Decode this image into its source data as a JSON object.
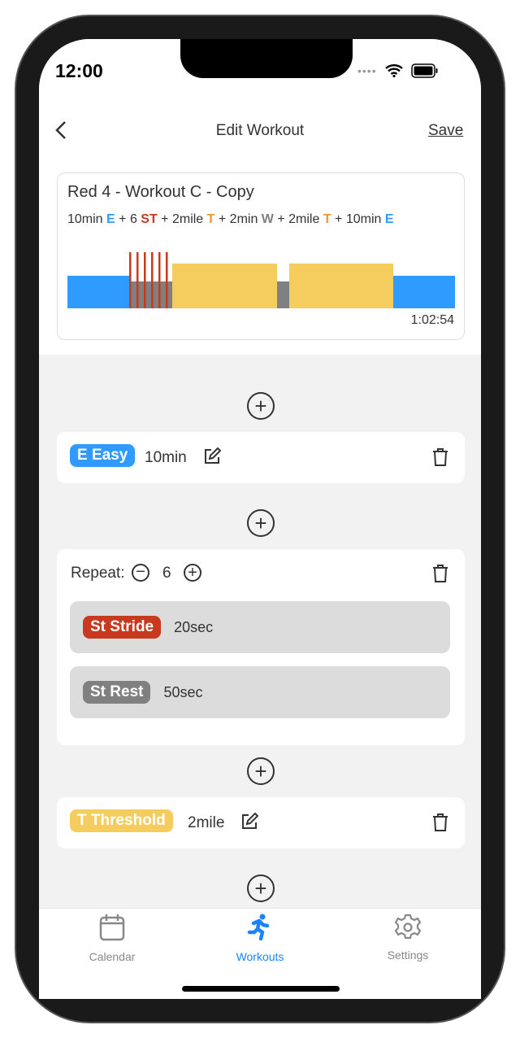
{
  "status": {
    "time": "12:00"
  },
  "header": {
    "title": "Edit Workout",
    "save_label": "Save"
  },
  "workout": {
    "name": "Red 4 - Workout C - Copy",
    "summary": [
      {
        "text": "10min "
      },
      {
        "code": "E",
        "color": "#2f9bff"
      },
      {
        "text": " + 6 "
      },
      {
        "code": "ST",
        "color": "#c8391e"
      },
      {
        "text": " + 2mile "
      },
      {
        "code": "T",
        "color": "#ec9a2a"
      },
      {
        "text": " + 2min "
      },
      {
        "code": "W",
        "color": "#808080"
      },
      {
        "text": " + 2mile "
      },
      {
        "code": "T",
        "color": "#ec9a2a"
      },
      {
        "text": " + 10min "
      },
      {
        "code": "E",
        "color": "#2f9bff"
      }
    ],
    "total_time": "1:02:54"
  },
  "colors": {
    "easy": "#2f9bff",
    "stride": "#c8391e",
    "rest": "#808080",
    "threshold": "#f5cd5e",
    "accent": "#1a84ff"
  },
  "steps": {
    "easy": {
      "badge": "E Easy",
      "value": "10min"
    },
    "repeat": {
      "label": "Repeat:",
      "count": "6",
      "stride": {
        "badge": "St Stride",
        "value": "20sec"
      },
      "rest": {
        "badge": "St Rest",
        "value": "50sec"
      }
    },
    "threshold": {
      "badge": "T Threshold",
      "value": "2mile"
    }
  },
  "tabs": [
    {
      "label": "Calendar",
      "icon": "calendar-icon"
    },
    {
      "label": "Workouts",
      "icon": "running-icon",
      "active": true
    },
    {
      "label": "Settings",
      "icon": "gear-icon"
    }
  ]
}
